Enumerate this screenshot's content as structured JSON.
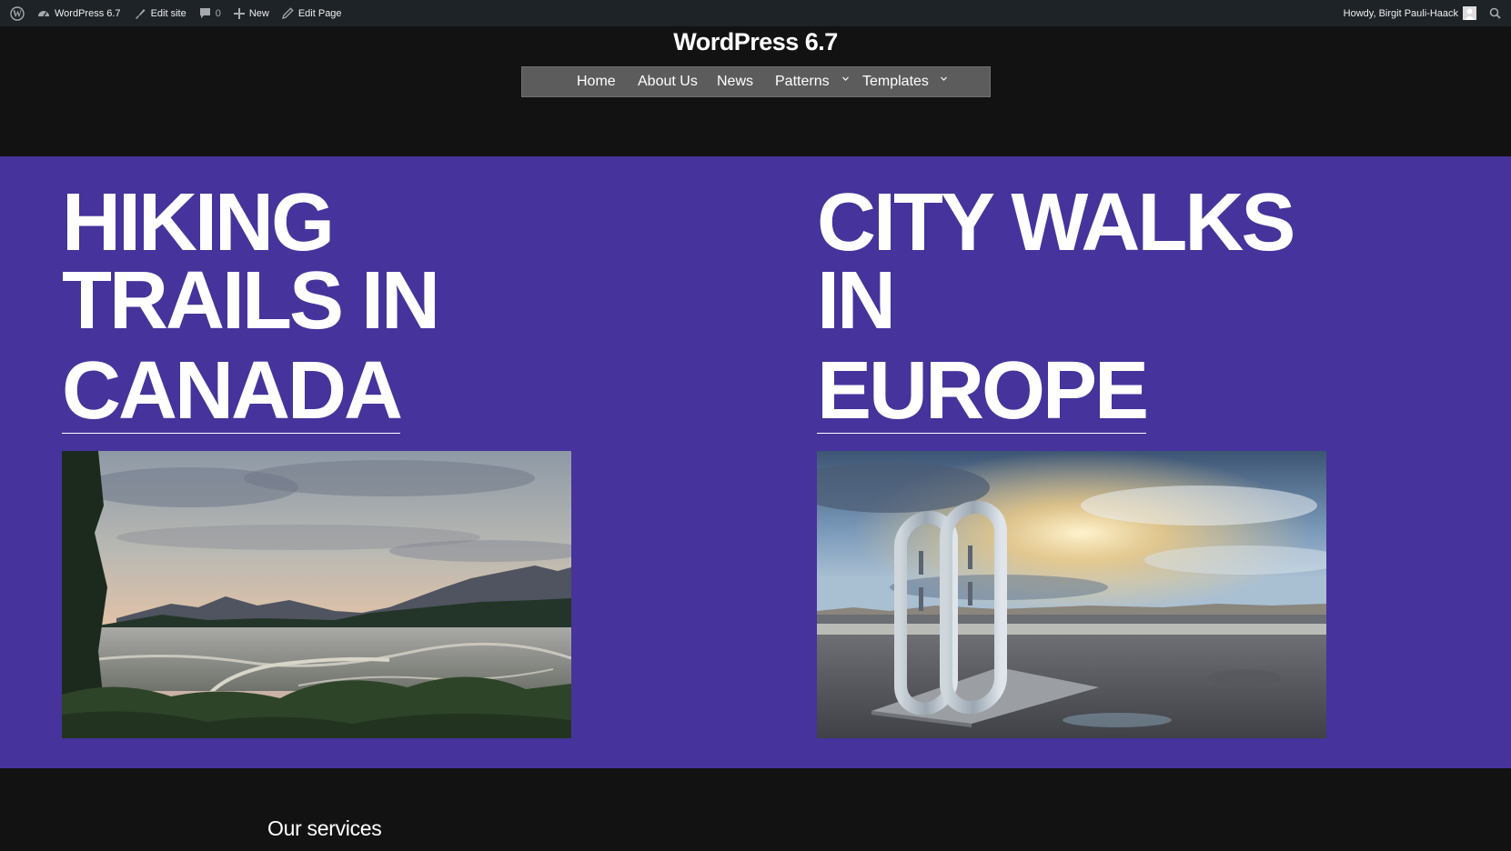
{
  "adminbar": {
    "site_name": "WordPress 6.7",
    "edit_site": "Edit site",
    "comments_count": "0",
    "new": "New",
    "edit_page": "Edit Page",
    "greeting": "Howdy, Birgit Pauli-Haack"
  },
  "header": {
    "site_title": "WordPress 6.7",
    "nav": {
      "home": "Home",
      "about": "About Us",
      "news": "News",
      "patterns": "Patterns",
      "templates": "Templates"
    }
  },
  "hero": {
    "left": {
      "line1": "HIKING",
      "line2": "TRAILS IN",
      "line3": "CANADA"
    },
    "right": {
      "line1": "CITY WALKS",
      "line2": "IN",
      "line3": "EUROPE"
    }
  },
  "services": {
    "heading": "Our services"
  },
  "colors": {
    "adminbar_bg": "#1d2327",
    "page_bg": "#121212",
    "hero_bg": "#46339b",
    "nav_bg": "#5c5c5c"
  }
}
